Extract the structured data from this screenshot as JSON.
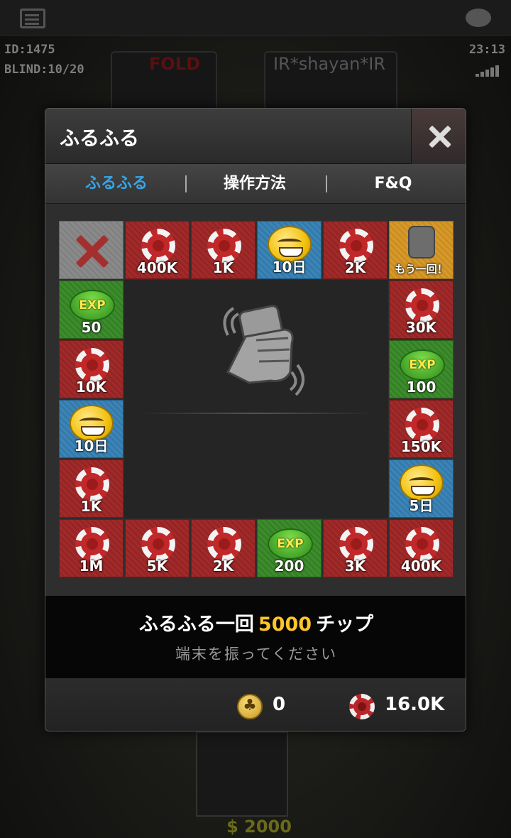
{
  "hud": {
    "id": "ID:1475",
    "blind": "BLIND:10/20",
    "time": "23:13"
  },
  "seats": {
    "fold_label": "FOLD",
    "player_name": "IR*shayan*IR"
  },
  "table": {
    "bottom_money": "$ 2000"
  },
  "dialog": {
    "title": "ふるふる",
    "tabs": [
      "ふるふる",
      "操作方法",
      "F&Q"
    ],
    "active_tab": 0,
    "info": {
      "prefix": "ふるふる一回",
      "count": "5000",
      "suffix": "チップ",
      "subtitle": "端末を振ってください"
    },
    "footer": {
      "coins": "0",
      "chips": "16.0K"
    }
  },
  "board": {
    "tiles": [
      {
        "type": "miss",
        "color": "gray",
        "label": ""
      },
      {
        "type": "chip",
        "color": "red",
        "label": "400K"
      },
      {
        "type": "chip",
        "color": "red",
        "label": "1K"
      },
      {
        "type": "smiley",
        "color": "blue",
        "label": "10日"
      },
      {
        "type": "chip",
        "color": "red",
        "label": "2K"
      },
      {
        "type": "again",
        "color": "orange",
        "label": "もう一回！"
      },
      {
        "type": "chip",
        "color": "red",
        "label": "30K"
      },
      {
        "type": "exp",
        "color": "green",
        "label": "100"
      },
      {
        "type": "chip",
        "color": "red",
        "label": "150K"
      },
      {
        "type": "smiley",
        "color": "blue",
        "label": "5日"
      },
      {
        "type": "chip",
        "color": "red",
        "label": "400K"
      },
      {
        "type": "chip",
        "color": "red",
        "label": "3K"
      },
      {
        "type": "exp",
        "color": "green",
        "label": "200"
      },
      {
        "type": "chip",
        "color": "red",
        "label": "2K"
      },
      {
        "type": "chip",
        "color": "red",
        "label": "5K"
      },
      {
        "type": "chip",
        "color": "red",
        "label": "1M"
      },
      {
        "type": "chip",
        "color": "red",
        "label": "1K"
      },
      {
        "type": "smiley",
        "color": "blue",
        "label": "10日"
      },
      {
        "type": "chip",
        "color": "red",
        "label": "10K"
      },
      {
        "type": "exp",
        "color": "green",
        "label": "50"
      }
    ],
    "exp_text": "EXP"
  },
  "colors": {
    "accent_tab": "#35a6e8",
    "highlight": "#ffc62a"
  }
}
